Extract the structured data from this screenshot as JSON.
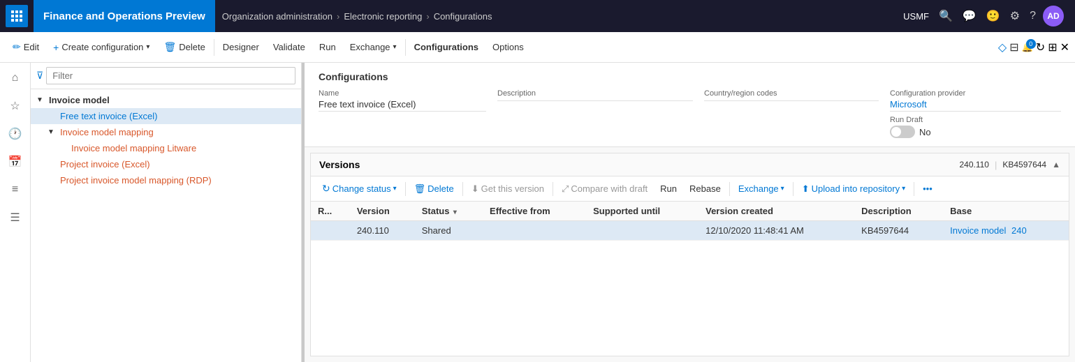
{
  "topnav": {
    "app_title": "Finance and Operations Preview",
    "breadcrumb": [
      {
        "label": "Organization administration",
        "sep": "›"
      },
      {
        "label": "Electronic reporting",
        "sep": "›"
      },
      {
        "label": "Configurations",
        "sep": ""
      }
    ],
    "user": "USMF",
    "user_initials": "AD"
  },
  "commandbar": {
    "edit": "Edit",
    "create_config": "Create configuration",
    "delete": "Delete",
    "designer": "Designer",
    "validate": "Validate",
    "run": "Run",
    "exchange": "Exchange",
    "configurations": "Configurations",
    "options": "Options"
  },
  "tree": {
    "filter_placeholder": "Filter",
    "items": [
      {
        "id": "invoice-model",
        "label": "Invoice model",
        "level": 1,
        "type": "root",
        "expand": "▼"
      },
      {
        "id": "free-text-invoice",
        "label": "Free text invoice (Excel)",
        "level": 2,
        "type": "selected",
        "expand": ""
      },
      {
        "id": "invoice-model-mapping",
        "label": "Invoice model mapping",
        "level": 2,
        "type": "orange",
        "expand": "▼"
      },
      {
        "id": "invoice-model-mapping-litware",
        "label": "Invoice model mapping Litware",
        "level": 3,
        "type": "orange",
        "expand": ""
      },
      {
        "id": "project-invoice",
        "label": "Project invoice (Excel)",
        "level": 2,
        "type": "orange",
        "expand": ""
      },
      {
        "id": "project-invoice-rdp",
        "label": "Project invoice model mapping (RDP)",
        "level": 2,
        "type": "orange",
        "expand": ""
      }
    ]
  },
  "config_panel": {
    "title": "Configurations",
    "fields": {
      "name_label": "Name",
      "name_value": "Free text invoice (Excel)",
      "description_label": "Description",
      "description_value": "",
      "country_label": "Country/region codes",
      "country_value": "",
      "provider_label": "Configuration provider",
      "provider_value": "Microsoft",
      "run_draft_label": "Run Draft",
      "run_draft_toggle": "off",
      "run_draft_text": "No"
    }
  },
  "versions": {
    "title": "Versions",
    "version_num": "240.110",
    "kb_num": "KB4597644",
    "toolbar": {
      "change_status": "Change status",
      "delete": "Delete",
      "get_this_version": "Get this version",
      "compare_with_draft": "Compare with draft",
      "run": "Run",
      "rebase": "Rebase",
      "exchange": "Exchange",
      "upload_into_repository": "Upload into repository"
    },
    "columns": [
      {
        "id": "r",
        "label": "R..."
      },
      {
        "id": "version",
        "label": "Version"
      },
      {
        "id": "status",
        "label": "Status"
      },
      {
        "id": "effective_from",
        "label": "Effective from"
      },
      {
        "id": "supported_until",
        "label": "Supported until"
      },
      {
        "id": "version_created",
        "label": "Version created"
      },
      {
        "id": "description",
        "label": "Description"
      },
      {
        "id": "base",
        "label": "Base"
      }
    ],
    "rows": [
      {
        "r": "",
        "version": "240.110",
        "status": "Shared",
        "effective_from": "",
        "supported_until": "",
        "version_created": "12/10/2020 11:48:41 AM",
        "description": "KB4597644",
        "base": "Invoice model",
        "base_num": "240",
        "selected": true
      }
    ]
  }
}
